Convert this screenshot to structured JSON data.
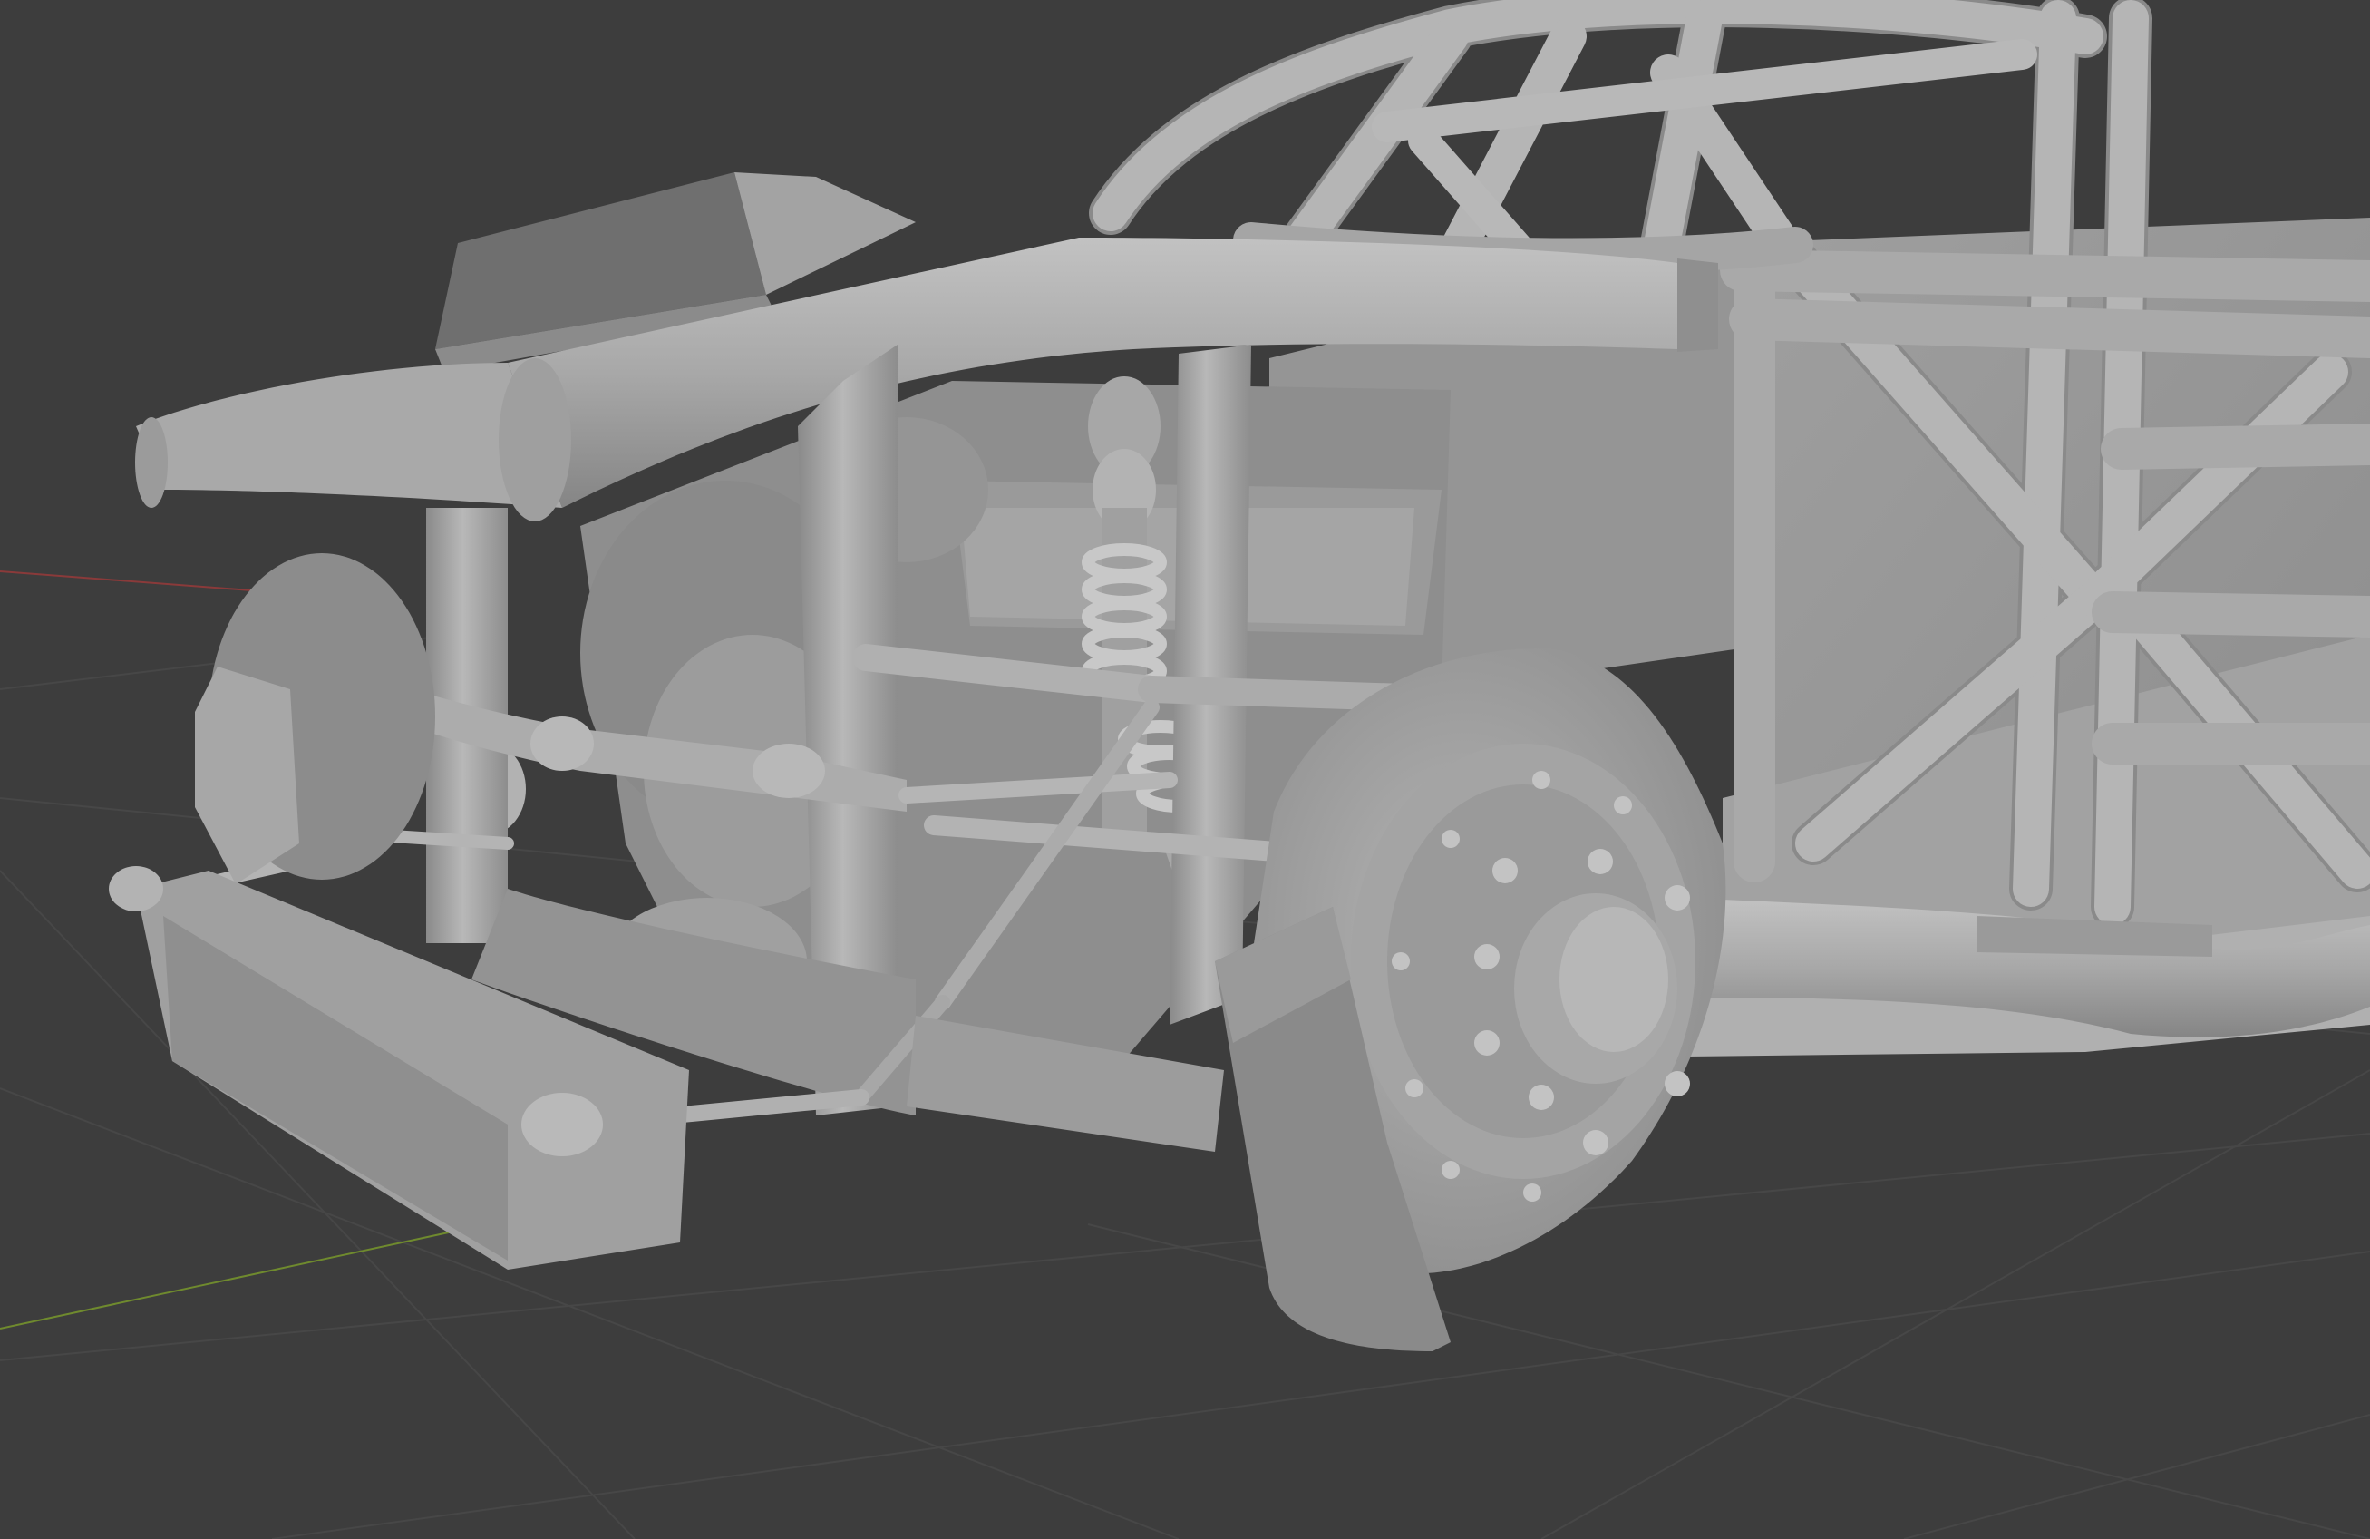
{
  "viewport": {
    "background_color": "#3d3d3d",
    "grid_color": "#474747",
    "x_axis_color": "#8a3a3a",
    "y_axis_color": "#6f8a2e",
    "mesh_color": "#a6a6a6",
    "mesh_shadow_color": "#7e7e7e",
    "mesh_highlight_color": "#c4c4c4"
  },
  "scene": {
    "objects": [
      "roll-cage",
      "chassis-floor-panel",
      "firewall-panel",
      "engine-block",
      "cold-air-intake-duct",
      "front-crossmember",
      "frame-rails",
      "coilover-shock",
      "steering-rack",
      "tie-rod",
      "upper-control-arm",
      "lower-control-arm",
      "brake-rotor",
      "brake-caliper",
      "wheel-hub",
      "sway-bar",
      "front-bumper-bar",
      "left-brake-rotor"
    ]
  }
}
